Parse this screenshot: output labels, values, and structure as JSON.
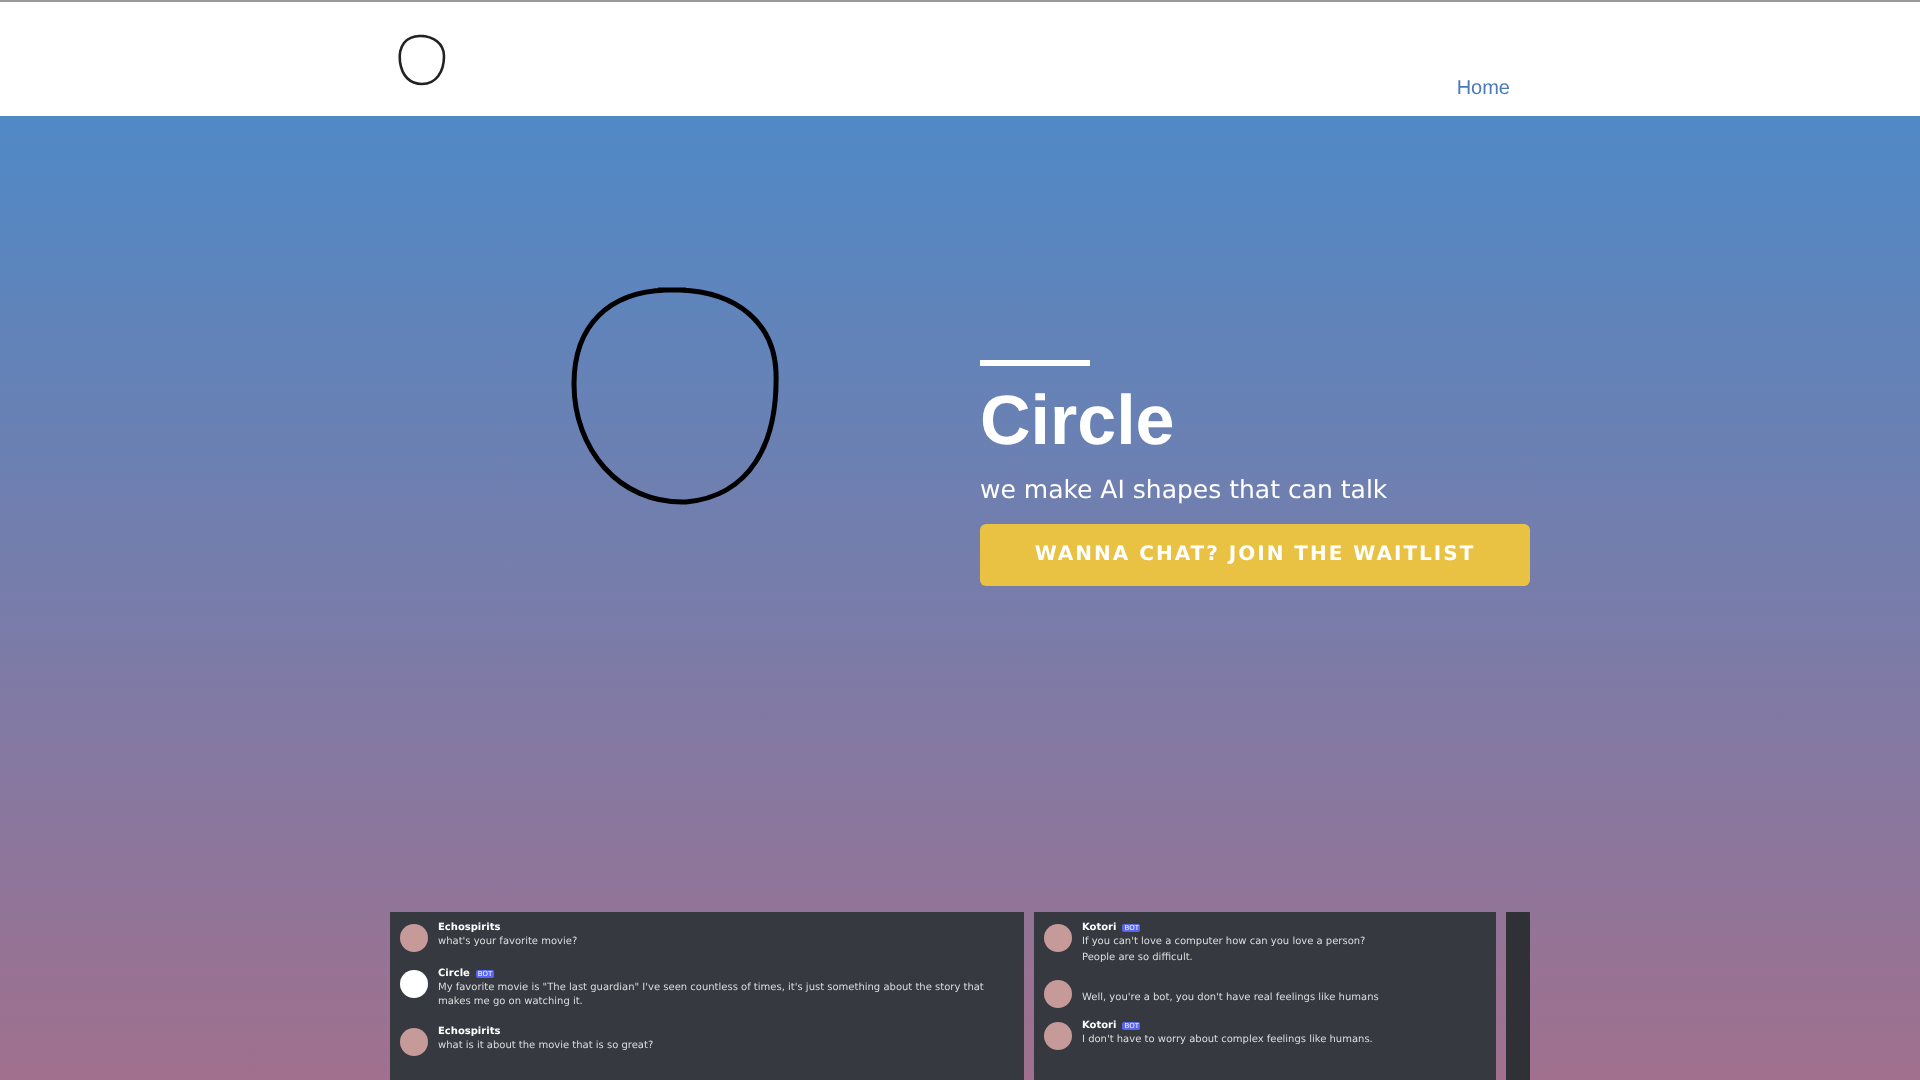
{
  "nav": {
    "links": [
      {
        "label": "Home"
      }
    ]
  },
  "hero": {
    "title": "Circle",
    "subtitle": "we make AI shapes that can talk",
    "cta": "WANNA CHAT? JOIN THE WAITLIST"
  },
  "screenshots": [
    {
      "messages": [
        {
          "author": "Echospirits",
          "kind": "photo",
          "lines": [
            "what's your favorite movie?"
          ]
        },
        {
          "author": "Circle",
          "badge": "BOT",
          "kind": "blank",
          "lines": [
            "My favorite movie is \"The last guardian\" I've seen countless of times, it's just something about the story that makes me go on watching it."
          ]
        },
        {
          "author": "Echospirits",
          "kind": "photo",
          "lines": [
            "what is it about the movie that is so great?"
          ]
        }
      ]
    },
    {
      "messages": [
        {
          "author": "Kotori",
          "badge": "BOT",
          "kind": "photo",
          "lines": [
            "If you can't love a computer how can you love a person?",
            "People are so difficult."
          ]
        },
        {
          "kind": "photo",
          "lines": [
            "Well, you're a bot, you don't have real feelings like humans"
          ]
        },
        {
          "author": "Kotori",
          "badge": "BOT",
          "kind": "photo",
          "lines": [
            "I don't have to worry about complex feelings like humans."
          ]
        }
      ]
    }
  ]
}
